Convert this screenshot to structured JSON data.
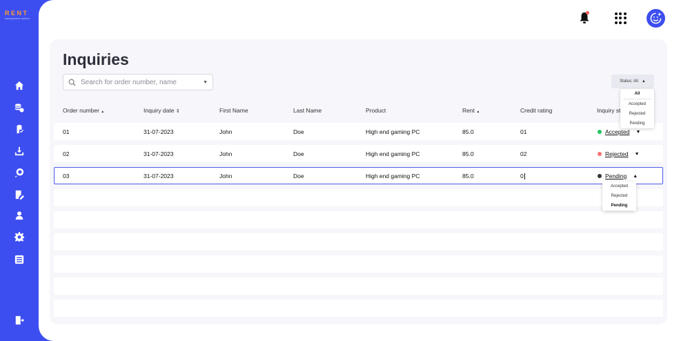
{
  "brand": {
    "title": "RENT",
    "subtitle": "management system"
  },
  "sidebar": {
    "items": [
      {
        "name": "home-icon"
      },
      {
        "name": "money-icon"
      },
      {
        "name": "clipboard-check-icon"
      },
      {
        "name": "download-icon"
      },
      {
        "name": "search-location-icon"
      },
      {
        "name": "edit-document-icon"
      },
      {
        "name": "user-icon"
      },
      {
        "name": "gear-icon"
      },
      {
        "name": "checklist-icon"
      },
      {
        "name": "logout-icon"
      }
    ]
  },
  "page": {
    "title": "Inquiries"
  },
  "search": {
    "placeholder": "Search for order number, name"
  },
  "status_filter": {
    "label": "Status: All",
    "options": [
      "All",
      "Accepted",
      "Rejected",
      "Pending"
    ],
    "selected": "All"
  },
  "table": {
    "headers": {
      "order_number": "Order number",
      "inquiry_date": "Inquiry date",
      "first_name": "First Name",
      "last_name": "Last Name",
      "product": "Product",
      "rent": "Rent",
      "credit_rating": "Credit rating",
      "inquiry_status": "Inquiry st"
    },
    "rows": [
      {
        "order": "01",
        "date": "31-07-2023",
        "first": "John",
        "last": "Doe",
        "product": "High end gaming PC",
        "rent": "85.0",
        "credit": "01",
        "status": "Accepted",
        "status_color": "#22c55e"
      },
      {
        "order": "02",
        "date": "31-07-2023",
        "first": "John",
        "last": "Doe",
        "product": "High end gaming PC",
        "rent": "85.0",
        "credit": "02",
        "status": "Rejected",
        "status_color": "#f87171"
      },
      {
        "order": "03",
        "date": "31-07-2023",
        "first": "John",
        "last": "Doe",
        "product": "High end gaming PC",
        "rent": "85.0",
        "credit": "0",
        "status": "Pending",
        "status_color": "#333333"
      }
    ]
  },
  "row_status_dropdown": {
    "options": [
      "Accepted",
      "Rejected",
      "Pending"
    ],
    "selected": "Pending"
  },
  "colors": {
    "accent": "#3d4ef0",
    "brand_orange": "#ff9a2e"
  }
}
